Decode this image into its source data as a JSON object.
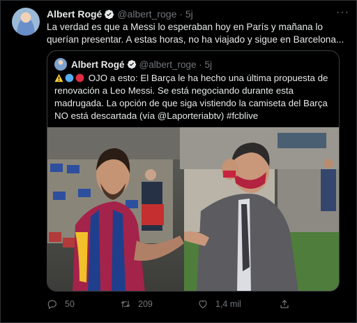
{
  "tweet": {
    "author_name": "Albert Rogé",
    "handle_time": "@albert_roge · 5j",
    "more_label": "···",
    "text": "La verdad es que a Messi lo esperaban hoy en París y mañana lo querían presentar. A estas horas, no ha viajado y sigue en Barcelona..."
  },
  "quote": {
    "author_name": "Albert Rogé",
    "handle_time": "@albert_roge · 5j",
    "text": "OJO a esto: El Barça le ha hecho una última propuesta de renovación a Leo Messi. Se está negociando durante esta madrugada. La opción de que siga vistiendo la camiseta del Barça NO está descartada (vía @Laporteriabtv) #fcblive"
  },
  "actions": {
    "replies": "50",
    "retweets": "209",
    "likes": "1,4 mil"
  },
  "icons": {
    "verified": "verified-badge-icon",
    "reply": "reply-icon",
    "retweet": "retweet-icon",
    "like": "heart-icon",
    "share": "share-icon"
  },
  "colors": {
    "background": "#000000",
    "text": "#e7e9ea",
    "muted": "#71767b",
    "verified": "#1d9bf0"
  }
}
